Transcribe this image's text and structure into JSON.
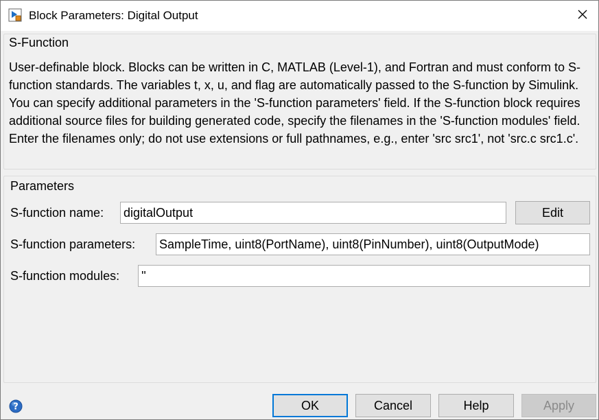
{
  "window": {
    "title": "Block Parameters: Digital Output"
  },
  "sfunction_group": {
    "title": "S-Function",
    "description": "User-definable block.  Blocks can be written in C, MATLAB (Level-1), and Fortran and must conform to S-function standards.  The variables t, x, u, and flag are automatically passed to the S-function by Simulink.  You can specify additional parameters in the 'S-function parameters' field. If the S-function block requires additional source files for building generated code, specify the filenames in the 'S-function modules' field. Enter the filenames only; do not use extensions or full pathnames, e.g., enter 'src src1', not 'src.c src1.c'."
  },
  "parameters_group": {
    "title": "Parameters",
    "name_label": "S-function name:",
    "name_value": "digitalOutput",
    "edit_label": "Edit",
    "params_label": "S-function parameters:",
    "params_value": "SampleTime, uint8(PortName), uint8(PinNumber), uint8(OutputMode)",
    "modules_label": "S-function modules:",
    "modules_value": "''"
  },
  "footer": {
    "ok_label": "OK",
    "cancel_label": "Cancel",
    "help_label": "Help",
    "apply_label": "Apply"
  },
  "icons": {
    "app": "simulink-block-icon",
    "close": "close-icon",
    "help": "help-icon"
  },
  "colors": {
    "default_button_border": "#0078d7",
    "window_background": "#f0f0f0",
    "help_icon": "#2c6cc4"
  }
}
